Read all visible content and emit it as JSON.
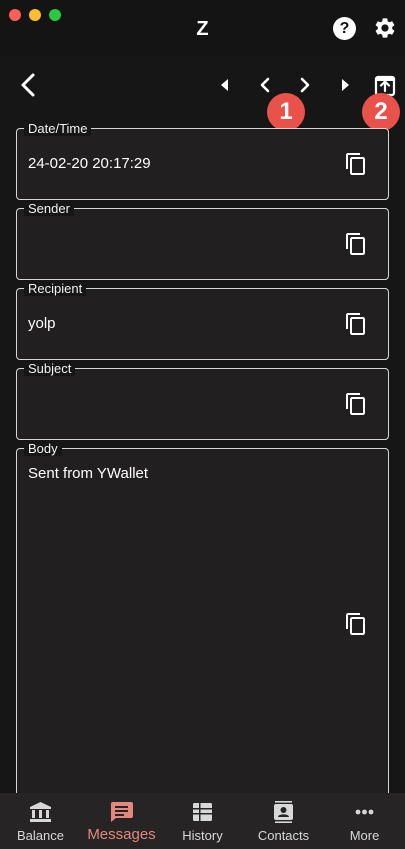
{
  "window": {
    "title": "Z"
  },
  "toolbar": {
    "help_label": "?"
  },
  "annotations": {
    "badge1": "1",
    "badge2": "2"
  },
  "fields": {
    "datetime": {
      "label": "Date/Time",
      "value": "24-02-20 20:17:29"
    },
    "sender": {
      "label": "Sender",
      "value": ""
    },
    "recipient": {
      "label": "Recipient",
      "value": "yolp"
    },
    "subject": {
      "label": "Subject",
      "value": ""
    },
    "body": {
      "label": "Body",
      "value": "Sent from YWallet"
    }
  },
  "bottom_nav": {
    "items": [
      {
        "label": "Balance",
        "icon": "bank-icon"
      },
      {
        "label": "Messages",
        "icon": "message-icon",
        "active": true
      },
      {
        "label": "History",
        "icon": "history-icon"
      },
      {
        "label": "Contacts",
        "icon": "contacts-icon"
      },
      {
        "label": "More",
        "icon": "more-icon"
      }
    ]
  },
  "colors": {
    "background": "#171616",
    "active_nav": "#e3877f",
    "badge": "#e9524a",
    "field_border": "#d7d7d7"
  }
}
